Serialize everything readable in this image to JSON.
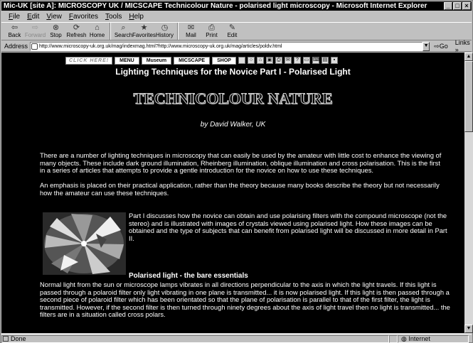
{
  "window": {
    "title": "Mic-UK [site A]: MICROSCOPY UK / MICSCAPE Technicolour Nature - polarised light microscopy - Microsoft Internet Explorer"
  },
  "menubar": [
    "File",
    "Edit",
    "View",
    "Favorites",
    "Tools",
    "Help"
  ],
  "toolbar": {
    "back": "Back",
    "forward": "Forward",
    "stop": "Stop",
    "refresh": "Refresh",
    "home": "Home",
    "search": "Search",
    "favorites": "Favorites",
    "history": "History",
    "mail": "Mail",
    "print": "Print",
    "edit": "Edit"
  },
  "address": {
    "label": "Address",
    "url": "http://www.microscopy-uk.org.uk/mag/indexmag.html?http://www.microscopy-uk.org.uk/mag/articles/poldv.html",
    "go": "Go",
    "links": "Links"
  },
  "sitenav": {
    "click_here": "CLICK HERE!",
    "menu": "MENU",
    "museum": "Museum",
    "micscape": "MICSCAPE",
    "shop": "SHOP"
  },
  "article": {
    "headline": "Lighting Techniques for the Novice Part I - Polarised Light",
    "logo": "TECHNICOLOUR NATURE",
    "byline": "by David Walker, UK",
    "intro": "There are a number of lighting techniques in microscopy that can easily be used by the amateur with little cost to enhance the viewing of many objects. These include dark ground illumination, Rheinberg illumination, oblique illumination and cross polarisation. This is the first in a series of articles that attempts to provide a gentle introduction for the novice on how to use these techniques.",
    "emphasis": "An emphasis is placed on their practical application, rather than the theory because many books describe the theory but not necessarily how the amateur can use these techniques.",
    "part1": "Part I discusses how the novice can obtain and use polarising filters with the compound microscope (not the stereo) and is illustrated with images of crystals viewed using polarised light. How these images can be obtained and the type of subjects that can benefit from polarised light will be discussed in more detail in Part II.",
    "subhead": "Polarised light - the bare essentials",
    "essentials": "Normal light from the sun or microscope lamps vibrates in all directions perpendicular to the axis in which the light travels. If this light is passed through a polaroid filter only light vibrating in one plane is transmitted... it is now polarised light. If this light is then passed through a second piece of polaroid filter which has been orientated so that the plane of polarisation is parallel to that of the first filter, the light is transmitted. However, if the second filter is then turned through ninety degrees about the axis of light travel then no light is transmitted... the filters are in a situation called cross polars."
  },
  "status": {
    "text": "Done",
    "zone": "Internet"
  }
}
